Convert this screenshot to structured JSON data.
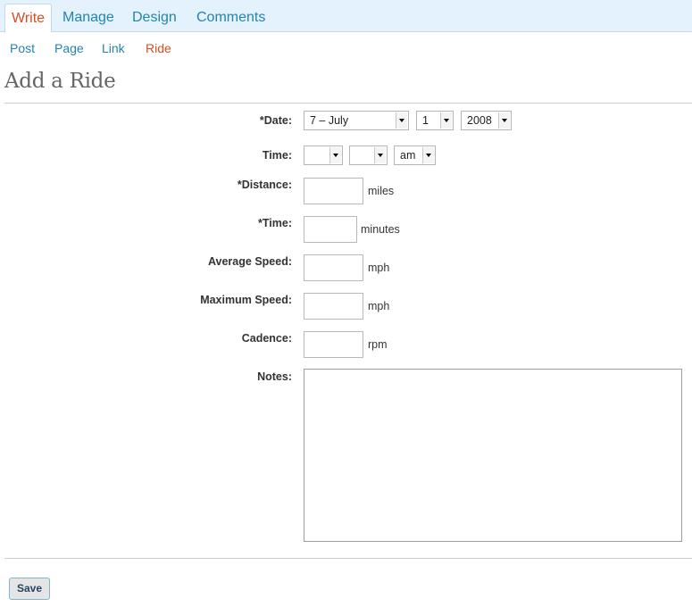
{
  "tabs": [
    {
      "label": "Write"
    },
    {
      "label": "Manage"
    },
    {
      "label": "Design"
    },
    {
      "label": "Comments"
    }
  ],
  "subnav": [
    {
      "label": "Post"
    },
    {
      "label": "Page"
    },
    {
      "label": "Link"
    },
    {
      "label": "Ride"
    }
  ],
  "page_title": "Add a Ride",
  "form": {
    "date": {
      "label": "*Date:",
      "month": "7 – July",
      "day": "1",
      "year": "2008"
    },
    "time": {
      "label": "Time:",
      "hour": "",
      "minute": "",
      "ampm": "am"
    },
    "distance": {
      "label": "*Distance:",
      "value": "",
      "unit": "miles"
    },
    "duration": {
      "label": "*Time:",
      "value": "",
      "unit": "minutes"
    },
    "avg_speed": {
      "label": "Average Speed:",
      "value": "",
      "unit": "mph"
    },
    "max_speed": {
      "label": "Maximum Speed:",
      "value": "",
      "unit": "mph"
    },
    "cadence": {
      "label": "Cadence:",
      "value": "",
      "unit": "rpm"
    },
    "notes": {
      "label": "Notes:",
      "value": ""
    }
  },
  "save_label": "Save",
  "colors": {
    "tab_bar_bg": "#e4f2fd",
    "link": "#2583ad",
    "active": "#d54e21"
  }
}
